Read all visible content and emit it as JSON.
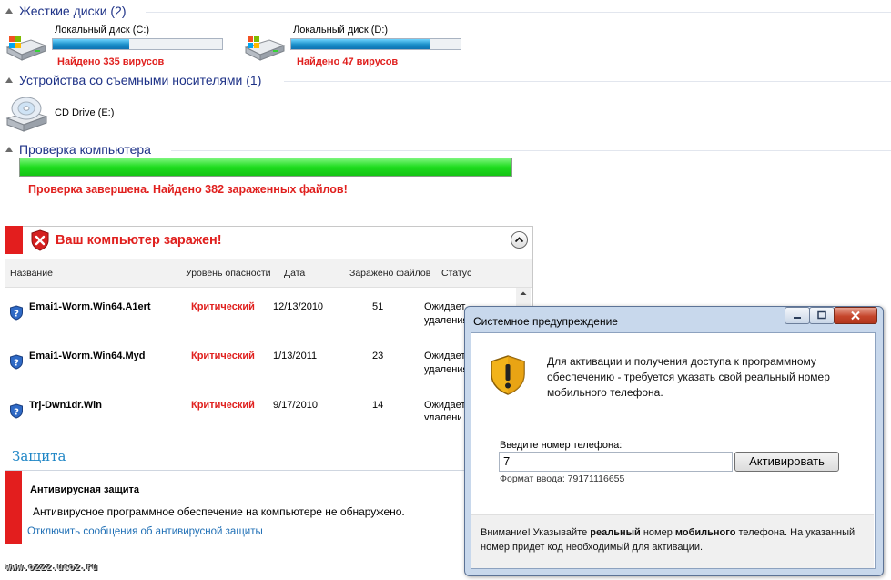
{
  "drives_section": {
    "title": "Жесткие диски (2)",
    "drives": [
      {
        "name": "Локальный диск (C:)",
        "usage": 0.45,
        "status": "Найдено 335 вирусов"
      },
      {
        "name": "Локальный диск (D:)",
        "usage": 0.82,
        "status": "Найдено 47 вирусов"
      }
    ]
  },
  "removable_section": {
    "title": "Устройства со съемными носителями (1)",
    "device": "CD Drive (E:)"
  },
  "scan_section": {
    "title": "Проверка компьютера",
    "progress": 1.0,
    "result": "Проверка завершена. Найдено 382 зараженных файлов!"
  },
  "infected_panel": {
    "title": "Ваш компьютер заражен!",
    "columns": [
      "Название",
      "Уровень опасности",
      "Дата",
      "Заражено файлов",
      "Статус"
    ],
    "rows": [
      {
        "name": "Emai1-Worm.Win64.A1ert",
        "level": "Критический",
        "date": "12/13/2010",
        "count": "51",
        "status1": "Ожидает",
        "status2": "удаления"
      },
      {
        "name": "Emai1-Worm.Win64.Myd",
        "level": "Критический",
        "date": "1/13/2011",
        "count": "23",
        "status1": "Ожидает",
        "status2": "удаления"
      },
      {
        "name": "Trj-Dwn1dr.Win",
        "level": "Критический",
        "date": "9/17/2010",
        "count": "14",
        "status1": "Ожидает",
        "status2": "удаления"
      }
    ]
  },
  "protection_section": {
    "title": "Защита",
    "item_title": "Антивирусная защита",
    "item_text": "Антивирусное программное обеспечение на компьютере не обнаружено.",
    "link": "Отключить сообщения об антивирусной защиты"
  },
  "watermark": "www.ozzz.ucoz.ru",
  "dialog": {
    "title": "Системное предупреждение",
    "message": "Для активации и получения доступа к программному обеспечению - требуется указать свой реальный номер мобильного телефона.",
    "phone_label": "Введите номер телефона:",
    "phone_value": "7",
    "button": "Активировать",
    "format": "Формат ввода: 79171116655",
    "footer_pre": "Внимание! Указывайте ",
    "footer_b1": "реальный",
    "footer_mid": " номер ",
    "footer_b2": "мобильного",
    "footer_post": " телефона. На указанный номер придет код необходимый для активации."
  },
  "colors": {
    "section_title": "#1e3287",
    "alert_red": "#e0201e",
    "progress_green": "#1fdc1f",
    "link_blue": "#1f6fb5"
  }
}
